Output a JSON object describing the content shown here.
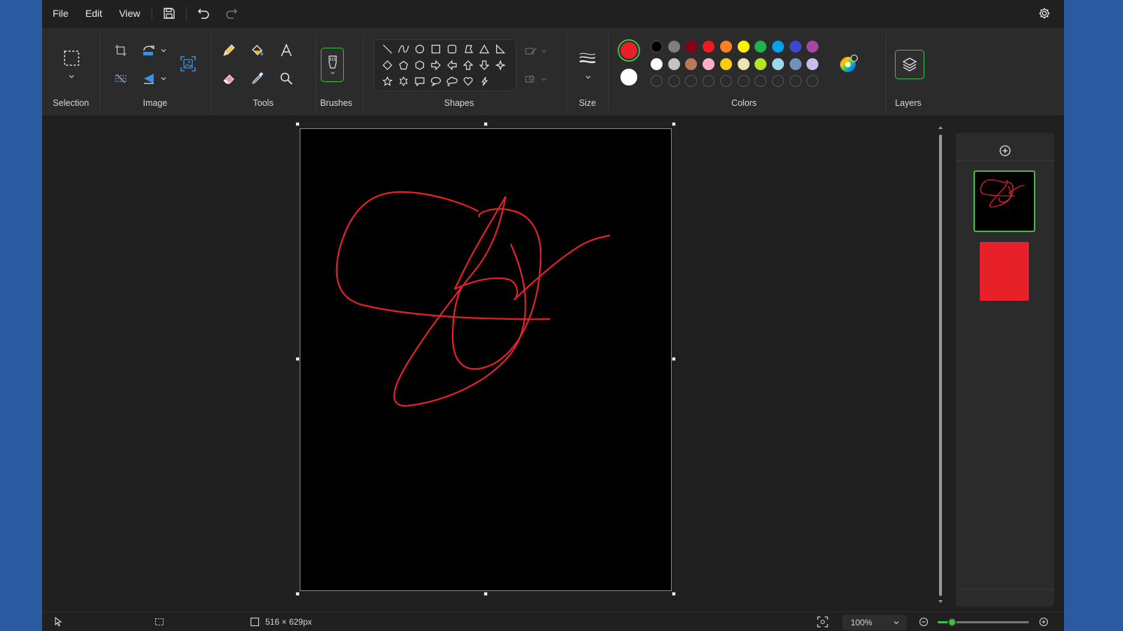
{
  "menu": {
    "file": "File",
    "edit": "Edit",
    "view": "View"
  },
  "ribbon": {
    "selection_label": "Selection",
    "image_label": "Image",
    "tools_label": "Tools",
    "brushes_label": "Brushes",
    "shapes_label": "Shapes",
    "size_label": "Size",
    "colors_label": "Colors",
    "layers_label": "Layers"
  },
  "colors": {
    "primary": "#e8202a",
    "secondary": "#ffffff",
    "palette_row1": [
      "#000000",
      "#7f7f7f",
      "#880015",
      "#ed1c24",
      "#ff7f27",
      "#fff200",
      "#22b14c",
      "#00a2e8",
      "#3f48cc",
      "#a349a4"
    ],
    "palette_row2": [
      "#ffffff",
      "#c3c3c3",
      "#b97a57",
      "#ffaec9",
      "#ffc90e",
      "#efe4b0",
      "#b5e61d",
      "#99d9ea",
      "#7092be",
      "#c8bfe7"
    ],
    "accent": "#3fbf48"
  },
  "layers": {
    "background_color": "#e8202a"
  },
  "statusbar": {
    "canvas_size": "516 × 629px",
    "zoom": "100%"
  },
  "zoom_level_fraction": 0.15
}
